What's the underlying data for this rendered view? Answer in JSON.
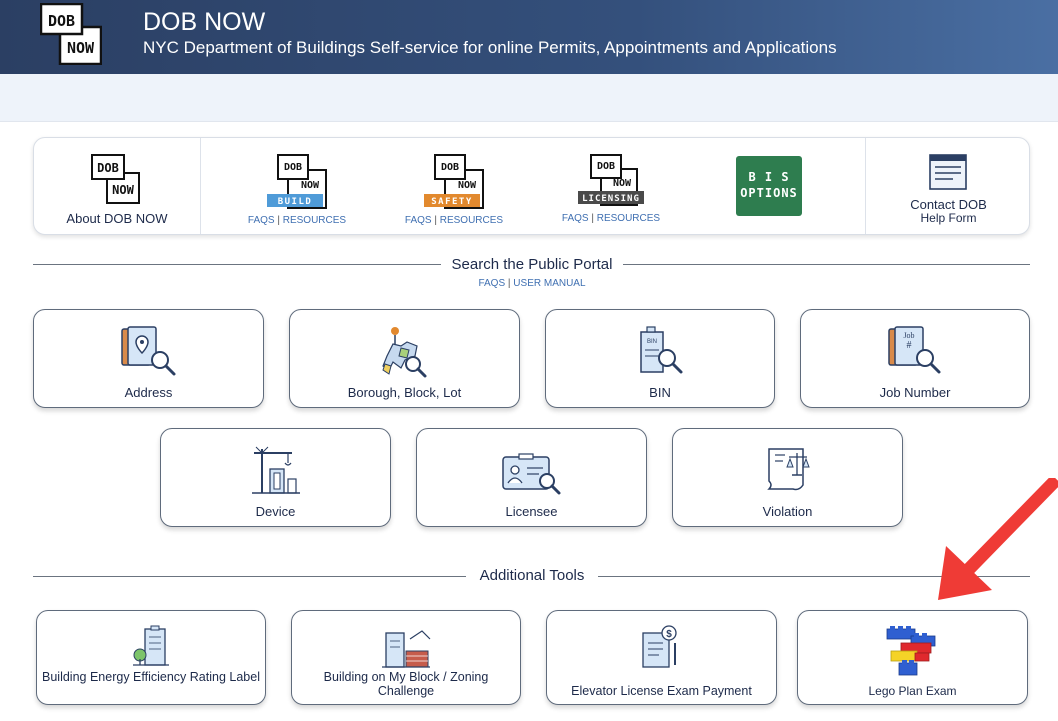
{
  "header": {
    "logo_line1": "DOB",
    "logo_line2": "NOW",
    "title": "DOB NOW",
    "subtitle": "NYC Department of Buildings Self-service for online Permits, Appointments and Applications"
  },
  "topbar": {
    "about": {
      "logo_line1": "DOB",
      "logo_line2": "NOW",
      "label": "About DOB NOW"
    },
    "build": {
      "logo_line1": "DOB",
      "logo_line2": "NOW",
      "tag": "BUILD",
      "faqs": "FAQS",
      "sep": "|",
      "resources": "RESOURCES"
    },
    "safety": {
      "logo_line1": "DOB",
      "logo_line2": "NOW",
      "tag": "SAFETY",
      "faqs": "FAQS",
      "sep": "|",
      "resources": "RESOURCES"
    },
    "licensing": {
      "logo_line1": "DOB",
      "logo_line2": "NOW",
      "tag": "LICENSING",
      "faqs": "FAQS",
      "sep": "|",
      "resources": "RESOURCES"
    },
    "bis": {
      "line1": "B I S",
      "line2": "OPTIONS"
    },
    "contact": {
      "line1": "Contact DOB",
      "line2": "Help Form"
    }
  },
  "search_portal": {
    "title": "Search the Public Portal",
    "faqs": "FAQS",
    "sep": "|",
    "manual": "USER MANUAL",
    "cards": [
      {
        "label": "Address",
        "icon": "address-search-icon"
      },
      {
        "label": "Borough, Block, Lot",
        "icon": "borough-map-icon"
      },
      {
        "label": "BIN",
        "icon": "bin-search-icon"
      },
      {
        "label": "Job Number",
        "icon": "job-number-search-icon"
      },
      {
        "label": "Device",
        "icon": "crane-device-icon"
      },
      {
        "label": "Licensee",
        "icon": "license-card-icon"
      },
      {
        "label": "Violation",
        "icon": "violation-scales-icon"
      }
    ]
  },
  "additional_tools": {
    "title": "Additional Tools",
    "cards": [
      {
        "label": "Building Energy Efficiency Rating Label",
        "icon": "energy-building-icon"
      },
      {
        "label": "Building on My Block / Zoning Challenge",
        "icon": "zoning-block-icon"
      },
      {
        "label": "Elevator License Exam Payment",
        "icon": "exam-payment-icon"
      },
      {
        "label": "Lego Plan Exam",
        "icon": "lego-bricks-icon"
      }
    ]
  },
  "colors": {
    "header_start": "#2b3f63",
    "header_end": "#4a6fa3",
    "build_tag": "#4f9bd8",
    "safety_tag": "#e2892e",
    "licensing_tag": "#4a4a4a",
    "bis_green": "#2e7d4f",
    "link_blue": "#3f6fb1",
    "arrow_red": "#ef3b36"
  }
}
